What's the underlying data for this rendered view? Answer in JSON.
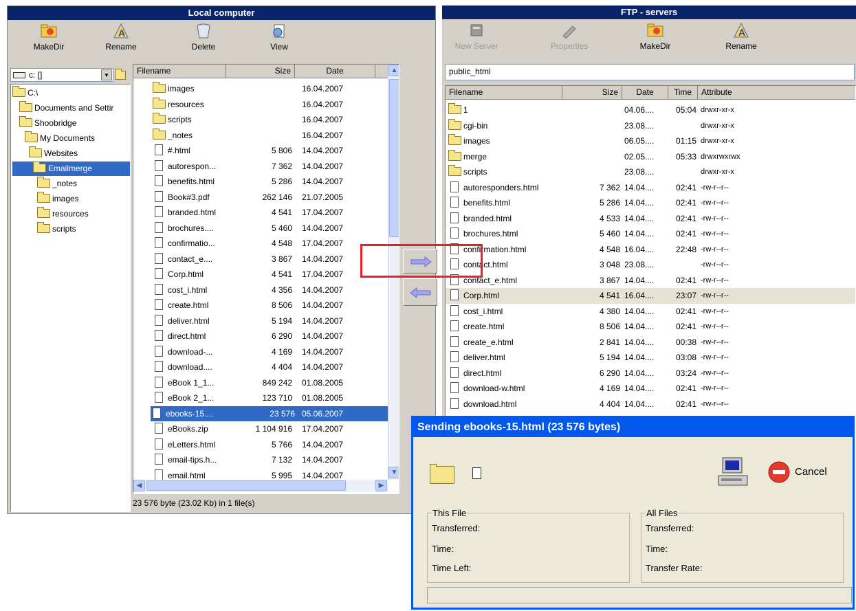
{
  "local": {
    "title": "Local computer",
    "toolbar": [
      {
        "label": "MakeDir",
        "icon": "makedir-icon"
      },
      {
        "label": "Rename",
        "icon": "rename-icon"
      },
      {
        "label": "Delete",
        "icon": "delete-icon"
      },
      {
        "label": "View",
        "icon": "view-icon"
      }
    ],
    "drive": "c: []",
    "tree": [
      "C:\\",
      "Documents and Settir",
      "Shoobridge",
      "My Documents",
      "Websites",
      "Emailmerge",
      "_notes",
      "images",
      "resources",
      "scripts"
    ],
    "columns": {
      "filename": "Filename",
      "size": "Size",
      "date": "Date"
    },
    "files": [
      {
        "name": "images",
        "size": "",
        "date": "16.04.2007",
        "folder": true
      },
      {
        "name": "resources",
        "size": "",
        "date": "16.04.2007",
        "folder": true
      },
      {
        "name": "scripts",
        "size": "",
        "date": "16.04.2007",
        "folder": true
      },
      {
        "name": "_notes",
        "size": "",
        "date": "16.04.2007",
        "folder": true
      },
      {
        "name": "#.html",
        "size": "5 806",
        "date": "14.04.2007"
      },
      {
        "name": "autorespon...",
        "size": "7 362",
        "date": "14.04.2007"
      },
      {
        "name": "benefits.html",
        "size": "5 286",
        "date": "14.04.2007"
      },
      {
        "name": "Book#3.pdf",
        "size": "262 146",
        "date": "21.07.2005"
      },
      {
        "name": "branded.html",
        "size": "4 541",
        "date": "17.04.2007"
      },
      {
        "name": "brochures....",
        "size": "5 460",
        "date": "14.04.2007"
      },
      {
        "name": "confirmatio...",
        "size": "4 548",
        "date": "17.04.2007"
      },
      {
        "name": "contact_e....",
        "size": "3 867",
        "date": "14.04.2007"
      },
      {
        "name": "Corp.html",
        "size": "4 541",
        "date": "17.04.2007"
      },
      {
        "name": "cost_i.html",
        "size": "4 356",
        "date": "14.04.2007"
      },
      {
        "name": "create.html",
        "size": "8 506",
        "date": "14.04.2007"
      },
      {
        "name": "deliver.html",
        "size": "5 194",
        "date": "14.04.2007"
      },
      {
        "name": "direct.html",
        "size": "6 290",
        "date": "14.04.2007"
      },
      {
        "name": "download-...",
        "size": "4 169",
        "date": "14.04.2007"
      },
      {
        "name": "download....",
        "size": "4 404",
        "date": "14.04.2007"
      },
      {
        "name": "eBook 1_1...",
        "size": "849 242",
        "date": "01.08.2005"
      },
      {
        "name": "eBook 2_1...",
        "size": "123 710",
        "date": "01.08.2005"
      },
      {
        "name": "ebooks-15....",
        "size": "23 576",
        "date": "05.06.2007",
        "selected": true
      },
      {
        "name": "eBooks.zip",
        "size": "1 104 916",
        "date": "17.04.2007"
      },
      {
        "name": "eLetters.html",
        "size": "5 766",
        "date": "14.04.2007"
      },
      {
        "name": "email-tips.h...",
        "size": "7 132",
        "date": "14.04.2007"
      },
      {
        "name": "email.html",
        "size": "5 995",
        "date": "14.04.2007"
      }
    ],
    "status": "23 576 byte (23.02 Kb) in 1 file(s)"
  },
  "transfer": {
    "upload_icon": "arrow-right-icon",
    "download_icon": "arrow-left-icon"
  },
  "remote": {
    "title": "FTP - servers",
    "toolbar": [
      {
        "label": "New Server",
        "icon": "new-server-icon",
        "disabled": true
      },
      {
        "label": "Properties",
        "icon": "properties-icon",
        "disabled": true
      },
      {
        "label": "MakeDir",
        "icon": "makedir-icon"
      },
      {
        "label": "Rename",
        "icon": "rename-icon"
      }
    ],
    "path": "public_html",
    "columns": {
      "filename": "Filename",
      "size": "Size",
      "date": "Date",
      "time": "Time",
      "attribute": "Attribute"
    },
    "files": [
      {
        "name": "1",
        "size": "",
        "date": "04.06....",
        "time": "05:04",
        "attr": "drwxr-xr-x",
        "folder": true
      },
      {
        "name": "cgi-bin",
        "size": "",
        "date": "23.08....",
        "time": "",
        "attr": "drwxr-xr-x",
        "folder": true
      },
      {
        "name": "images",
        "size": "",
        "date": "06.05....",
        "time": "01:15",
        "attr": "drwxr-xr-x",
        "folder": true
      },
      {
        "name": "merge",
        "size": "",
        "date": "02.05....",
        "time": "05:33",
        "attr": "drwxrwxrwx",
        "folder": true
      },
      {
        "name": "scripts",
        "size": "",
        "date": "23.08....",
        "time": "",
        "attr": "drwxr-xr-x",
        "folder": true
      },
      {
        "name": "autoresponders.html",
        "size": "7 362",
        "date": "14.04....",
        "time": "02:41",
        "attr": "-rw-r--r--"
      },
      {
        "name": "benefits.html",
        "size": "5 286",
        "date": "14.04....",
        "time": "02:41",
        "attr": "-rw-r--r--"
      },
      {
        "name": "branded.html",
        "size": "4 533",
        "date": "14.04....",
        "time": "02:41",
        "attr": "-rw-r--r--"
      },
      {
        "name": "brochures.html",
        "size": "5 460",
        "date": "14.04....",
        "time": "02:41",
        "attr": "-rw-r--r--"
      },
      {
        "name": "confirmation.html",
        "size": "4 548",
        "date": "16.04....",
        "time": "22:48",
        "attr": "-rw-r--r--"
      },
      {
        "name": "contact.html",
        "size": "3 048",
        "date": "23.08....",
        "time": "",
        "attr": "-rw-r--r--"
      },
      {
        "name": "contact_e.html",
        "size": "3 867",
        "date": "14.04....",
        "time": "02:41",
        "attr": "-rw-r--r--"
      },
      {
        "name": "Corp.html",
        "size": "4 541",
        "date": "16.04....",
        "time": "23:07",
        "attr": "-rw-r--r--",
        "highlight": true
      },
      {
        "name": "cost_i.html",
        "size": "4 380",
        "date": "14.04....",
        "time": "02:41",
        "attr": "-rw-r--r--"
      },
      {
        "name": "create.html",
        "size": "8 506",
        "date": "14.04....",
        "time": "02:41",
        "attr": "-rw-r--r--"
      },
      {
        "name": "create_e.html",
        "size": "2 841",
        "date": "14.04....",
        "time": "00:38",
        "attr": "-rw-r--r--"
      },
      {
        "name": "deliver.html",
        "size": "5 194",
        "date": "14.04....",
        "time": "03:08",
        "attr": "-rw-r--r--"
      },
      {
        "name": "direct.html",
        "size": "6 290",
        "date": "14.04....",
        "time": "03:24",
        "attr": "-rw-r--r--"
      },
      {
        "name": "download-w.html",
        "size": "4 169",
        "date": "14.04....",
        "time": "02:41",
        "attr": "-rw-r--r--"
      },
      {
        "name": "download.html",
        "size": "4 404",
        "date": "14.04....",
        "time": "02:41",
        "attr": "-rw-r--r--"
      }
    ]
  },
  "dialog": {
    "title": "Sending ebooks-15.html (23 576 bytes)",
    "cancel_label": "Cancel",
    "this_file": {
      "label": "This File",
      "transferred": "Transferred:",
      "time": "Time:",
      "time_left": "Time Left:"
    },
    "all_files": {
      "label": "All Files",
      "transferred": "Transferred:",
      "time": "Time:",
      "rate": "Transfer Rate:"
    },
    "progress": 0
  },
  "colors": {
    "titlebar": "#0a246a",
    "selection": "#3169c6",
    "dialog_title": "#0058ee",
    "annotation": "#e8202a"
  }
}
